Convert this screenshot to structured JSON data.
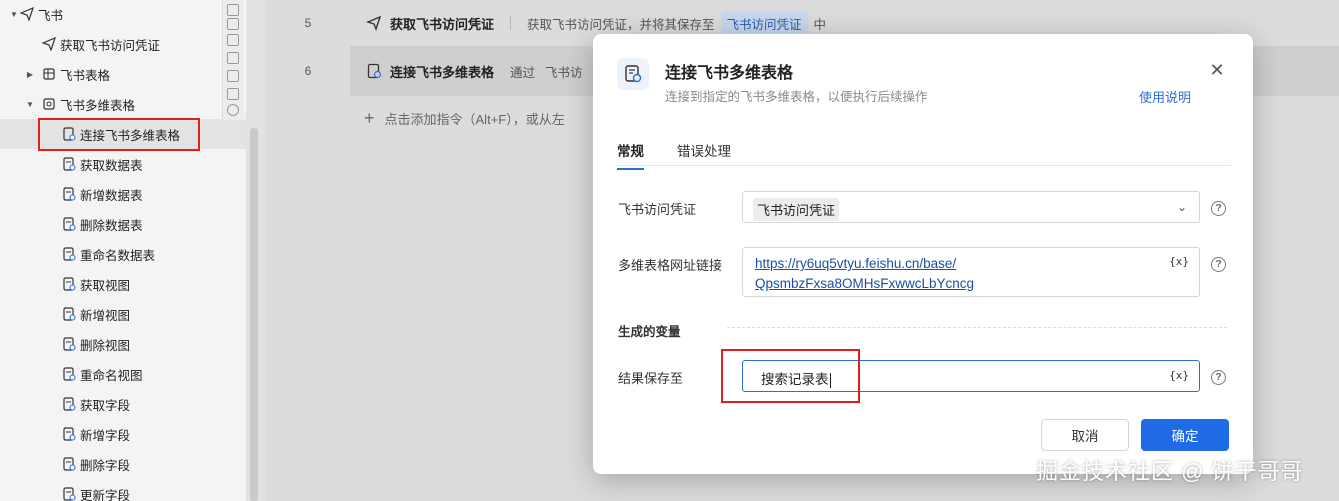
{
  "sidebar": {
    "items": [
      {
        "label": "飞书",
        "level": 0,
        "arrow": "expanded",
        "icon": "paper-plane-icon"
      },
      {
        "label": "获取飞书访问凭证",
        "level": 1,
        "arrow": "",
        "icon": "key-plane-icon"
      },
      {
        "label": "飞书表格",
        "level": 1,
        "arrow": "collapsed",
        "icon": "sheet-icon"
      },
      {
        "label": "飞书多维表格",
        "level": 1,
        "arrow": "expanded",
        "icon": "bitable-icon"
      },
      {
        "label": "连接飞书多维表格",
        "level": 2,
        "arrow": "",
        "icon": "doc-link-icon",
        "selected": true
      },
      {
        "label": "获取数据表",
        "level": 2,
        "arrow": "",
        "icon": "doc-icon"
      },
      {
        "label": "新增数据表",
        "level": 2,
        "arrow": "",
        "icon": "doc-icon"
      },
      {
        "label": "删除数据表",
        "level": 2,
        "arrow": "",
        "icon": "doc-icon"
      },
      {
        "label": "重命名数据表",
        "level": 2,
        "arrow": "",
        "icon": "doc-icon"
      },
      {
        "label": "获取视图",
        "level": 2,
        "arrow": "",
        "icon": "doc-icon"
      },
      {
        "label": "新增视图",
        "level": 2,
        "arrow": "",
        "icon": "doc-icon"
      },
      {
        "label": "删除视图",
        "level": 2,
        "arrow": "",
        "icon": "doc-icon"
      },
      {
        "label": "重命名视图",
        "level": 2,
        "arrow": "",
        "icon": "doc-icon"
      },
      {
        "label": "获取字段",
        "level": 2,
        "arrow": "",
        "icon": "doc-icon"
      },
      {
        "label": "新增字段",
        "level": 2,
        "arrow": "",
        "icon": "doc-icon"
      },
      {
        "label": "删除字段",
        "level": 2,
        "arrow": "",
        "icon": "doc-icon"
      },
      {
        "label": "更新字段",
        "level": 2,
        "arrow": "",
        "icon": "doc-icon"
      }
    ]
  },
  "steps": [
    {
      "num": "5",
      "title": "获取飞书访问凭证",
      "desc_prefix": "获取飞书访问凭证，并将其保存至",
      "var": "飞书访问凭证",
      "desc_suffix": "中",
      "icon": "key-plane-icon"
    },
    {
      "num": "6",
      "title": "连接飞书多维表格",
      "desc_prefix": "通过",
      "var": "飞书访",
      "desc_suffix": "",
      "icon": "doc-link-icon"
    }
  ],
  "add_hint": "点击添加指令（Alt+F），或从左",
  "modal": {
    "title": "连接飞书多维表格",
    "subtitle": "连接到指定的飞书多维表格，以便执行后续操作",
    "help_link": "使用说明",
    "close_icon": "close-icon",
    "tabs": [
      "常规",
      "错误处理"
    ],
    "active_tab": 0,
    "fields": {
      "credential": {
        "label": "飞书访问凭证",
        "value": "飞书访问凭证"
      },
      "url": {
        "label": "多维表格网址链接",
        "value_line1": "https://ry6uq5vtyu.feishu.cn/base/",
        "value_line2": "QpsmbzFxsa8OMHsFxwwcLbYcncg"
      },
      "section": "生成的变量",
      "result": {
        "label": "结果保存至",
        "value": "搜索记录表"
      }
    },
    "var_token": "{x}",
    "help_glyph": "?",
    "cancel_label": "取消",
    "ok_label": "确定"
  },
  "watermark": "掘金技术社区 @ 饼干哥哥",
  "colors": {
    "accent": "#1f6be6",
    "highlight": "#e02020",
    "link": "#2c6ed5"
  }
}
